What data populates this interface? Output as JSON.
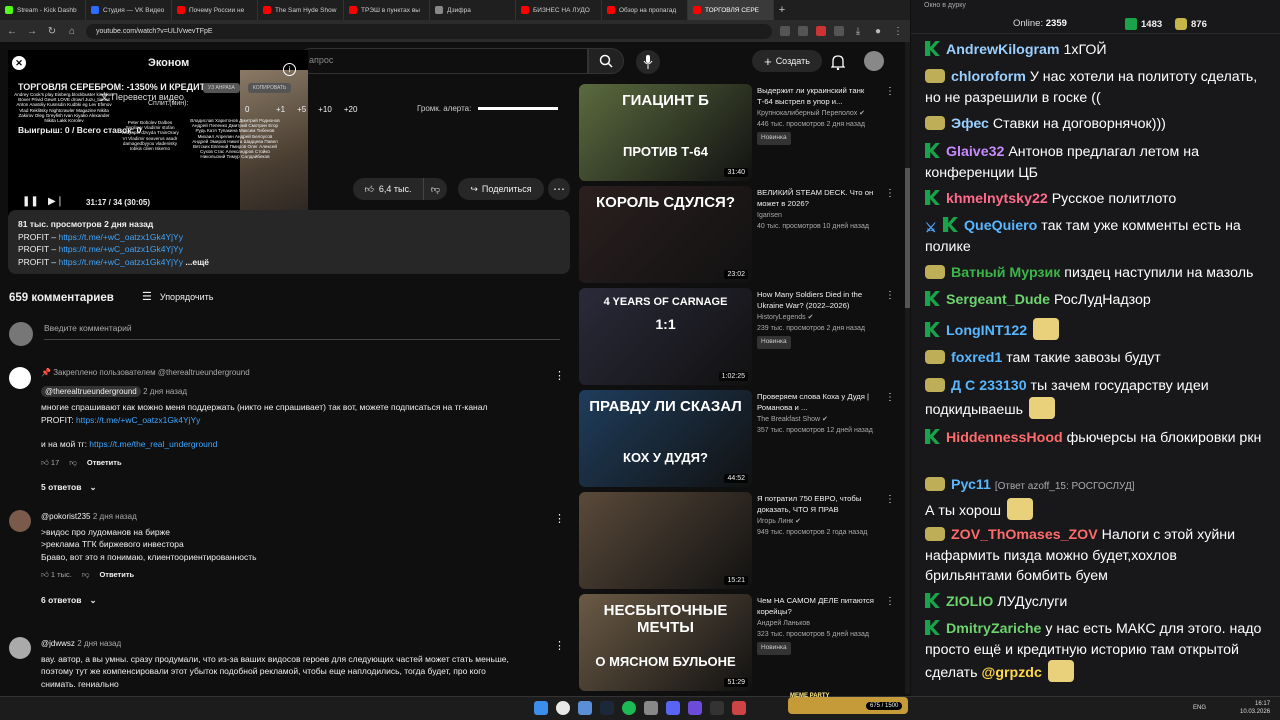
{
  "browser": {
    "tabs": [
      {
        "label": "Stream - Kick Dashb",
        "color": "#53fc18"
      },
      {
        "label": "Студия — VK Видео",
        "color": "#2c6bff"
      },
      {
        "label": "Почему России не",
        "color": "#ff0000"
      },
      {
        "label": "The Sam Hyde Show",
        "color": "#ff0000"
      },
      {
        "label": "ТРЭШ в пунктах вы",
        "color": "#ff0000"
      },
      {
        "label": "Дзифра",
        "color": "#888888"
      },
      {
        "label": "БИЗНЕС НА ЛУДО",
        "color": "#ff0000"
      },
      {
        "label": "Обзор на пропагад",
        "color": "#ff0000"
      },
      {
        "label": "ТОРГОВЛЯ СЕРЕ",
        "color": "#ff0000"
      }
    ],
    "new_tab": "+",
    "url": "youtube.com/watch?v=ULlVwevTFpE",
    "win_min": "—",
    "win_max": "☐",
    "win_close": "✕"
  },
  "header": {
    "search_placeholder": "апрос",
    "create_label": "Создать"
  },
  "overlay": {
    "brand": "Эконом",
    "title": "ТОРГОВЛЯ СЕРЕБРОМ: -1350% И КРЕДИТЫ",
    "translate": "Перевести видео",
    "chip1": "УЗ AHPA5A",
    "chip2": "КОПИРОВАТЬ",
    "split": "Сплит.(мин):",
    "counter": "0",
    "steps": [
      "+1",
      "+5",
      "+10",
      "+20"
    ],
    "volume_label": "Громк. алерта:",
    "line2": "Выигрыш: 0 / Всего ставок: 0",
    "time": "31:17 / 34 (30:05)",
    "names1": "Andrey Cook's play Eisberg.blockbuster kingdom Boxer Privid Gewrt LOVE drowrl Juzu_tiamut Anton Anatoliy Kusnsdin Kudbki eg Lev Efimov Vlad Reklitsky Nightcrawler Magazine Nikita Zakirov Oleg Greyfish Ivan Kiyako Alexander Nikita Lakk Korolev",
    "names2": "Peter Bobolev Dalbes Sepliavy Vladimir stofan Vedyapin dzvyda TrainOrary VI Vladimir seaverus asadr damagedbyyou vladenisky tobkis cilien Iskerno",
    "names3": "Владислав Харитонов Дмитрий Родионов Андрей Пепенко Дмитрий Смотрин Егор Рудь Катя Тупакина Максим Тибенов Михаил Апрелин Андрей Белоусов Андрей Эмиров Никита Шадцева Павел Вятских Евгений Пмиров Олег Алексей Сухов Стас Александров Стойко Никольский Тимур Салдайбеков"
  },
  "actions": {
    "likes": "6,4 тыс.",
    "share": "Поделиться"
  },
  "description": {
    "stats": "81 тыс. просмотров  2 дня назад",
    "profit_label": "PROFIT – ",
    "profit_link": "https://t.me/+wC_oatzx1Gk4YjYy",
    "more": "...ещё"
  },
  "comments": {
    "count": "659 комментариев",
    "sort": "Упорядочить",
    "input_placeholder": "Введите комментарий",
    "reply": "Ответить",
    "items": [
      {
        "pinned": "Закреплено пользователем @therealtrueunderground",
        "author": "@therealtrueunderground",
        "time": "2 дня назад",
        "line1": "многие спрашивают как можно меня поддержать (никто не спрашивает) так вот, можете подписаться на тг-канал",
        "line2_label": "PROFIT: ",
        "line2_link": "https://t.me/+wC_oatzx1Gk4YjYy",
        "line3_label": "и на мой тг: ",
        "line3_link": "https://t.me/the_real_underground",
        "likes": "17",
        "replies": "5 ответов"
      },
      {
        "author": "@pokorist235",
        "time": "2 дня назад",
        "line1": ">видос про лудоманов на бирже",
        "line2": ">реклама ТГК биржевого инвестора",
        "line3": "Браво, вот это я понимаю, клиентоориентированность",
        "likes": "1 тыс.",
        "replies": "6 ответов"
      },
      {
        "author": "@jdwwsz",
        "time": "2 дня назад",
        "line1": "вау. автор, а вы умны. сразу продумали, что из-за ваших видосов героев для следующих частей может стать меньше,",
        "line2": "поэтому тут же компенсировали этот убыток подобной рекламой, чтобы еще наплодились, тогда будет, про кого",
        "line3": "снимать. гениально"
      }
    ]
  },
  "recommendations": [
    {
      "thumb_text": "ГИАЦИНТ Б",
      "thumb_sub": "ПРОТИВ Т-64",
      "thumb_bg": "#5b6b3f",
      "title": "Выдержит ли украинский танк Т-64 выстрел в упор и...",
      "channel": "Крупнокалиберный Переполох ✔",
      "stats": "446 тыс. просмотров  2 дня назад",
      "badge": "Новинка",
      "duration": "31:40"
    },
    {
      "thumb_text": "КОРОЛЬ  СДУЛСЯ?",
      "thumb_sub": "",
      "thumb_bg": "#2b1f1f",
      "title": "ВЕЛИКИЙ STEAM DECK. Что он может в 2026?",
      "channel": "Igarisen",
      "stats": "40 тыс. просмотров  10 дней назад",
      "badge": "",
      "duration": "23:02"
    },
    {
      "thumb_text": "4 YEARS OF CARNAGE",
      "thumb_sub": "1:1",
      "thumb_bg": "#2a2a3a",
      "title": "How Many Soldiers Died in the Ukraine War? (2022–2026)",
      "channel": "HistoryLegends ✔",
      "stats": "239 тыс. просмотров  2 дня назад",
      "badge": "Новинка",
      "duration": "1:02:25"
    },
    {
      "thumb_text": "ПРАВДУ ЛИ СКАЗАЛ",
      "thumb_sub": "КОХ У ДУДЯ?",
      "thumb_bg": "#1f3d5c",
      "title": "Проверяем слова Коха у Дудя | Романова и ...",
      "channel": "The Breakfast Show ✔",
      "stats": "357 тыс. просмотров  12 дней назад",
      "badge": "",
      "duration": "44:52"
    },
    {
      "thumb_text": "",
      "thumb_sub": "",
      "thumb_bg": "#5a4a3a",
      "title": "Я потратил 750 ЕВРО, чтобы доказать, ЧТО Я ПРАВ",
      "channel": "Игорь Линк ✔",
      "stats": "949 тыс. просмотров  2 года назад",
      "badge": "",
      "duration": "15:21"
    },
    {
      "thumb_text": "НЕСБЫТОЧНЫЕ МЕЧТЫ",
      "thumb_sub": "О МЯСНОМ БУЛЬОНЕ",
      "thumb_bg": "#6b5a45",
      "title": "Чем НА САМОМ ДЕЛЕ питаются корейцы?",
      "channel": "Андрей Ланьков",
      "stats": "323 тыс. просмотров  5 дней назад",
      "badge": "Новинка",
      "duration": "51:29"
    }
  ],
  "chat": {
    "window_title": "Окно в дурку",
    "online_label": "Online:",
    "online_count": "2359",
    "stat1": "1483",
    "stat2": "876",
    "messages": [
      {
        "badge": "k",
        "nick": "AndrewKilogram",
        "color": "#9ad0ff",
        "text": "1хГОЙ"
      },
      {
        "badge": "y",
        "nick": "chloroform",
        "color": "#9ad0ff",
        "text": "У нас хотели на политоту сделать, но не разрешили в госке (("
      },
      {
        "badge": "y",
        "nick": "Эфес",
        "color": "#9ad0ff",
        "text": "Ставки на договорнячок)))"
      },
      {
        "badge": "k",
        "nick": "Glaive32",
        "color": "#c78bff",
        "text": "Антонов предлагал летом на конференции ЦБ"
      },
      {
        "badge": "k",
        "nick": "khmelnytsky22",
        "color": "#ff6b8a",
        "text": "Русское политлото"
      },
      {
        "badge": "xk",
        "nick": "QueQuiero",
        "color": "#58b7ff",
        "text": "так там уже комменты есть на полике"
      },
      {
        "badge": "y",
        "nick": "Ватный Мурзик",
        "color": "#3bb54a",
        "text": "пиздец наступили на мазоль"
      },
      {
        "badge": "k",
        "nick": "Sergeant_Dude",
        "color": "#6dd36d",
        "text": "РосЛудНадзор"
      },
      {
        "badge": "k",
        "nick": "LongINT122",
        "color": "#58b7ff",
        "text": ""
      },
      {
        "badge": "y",
        "nick": "foxred1",
        "color": "#58b7ff",
        "text": "там такие завозы будут"
      },
      {
        "badge": "y",
        "nick": "Д С 233130",
        "color": "#58b7ff",
        "text": "ты зачем государству идеи подкидываешь"
      },
      {
        "badge": "k",
        "nick": "HiddennessHood",
        "color": "#ff6b6b",
        "text": "фьючерсы на блокировки ркн"
      },
      {
        "badge": "y",
        "nick": "Рус11",
        "color": "#58b7ff",
        "reply": "[Ответ azoff_15: РОСГОСЛУД]",
        "text": "А ты хорош"
      },
      {
        "badge": "y",
        "nick": "ZOV_ThOmases_ZOV",
        "color": "#ff6b6b",
        "text": "Налоги с этой хуйни нафармить пизда можно будет,хохлов брильянтами бомбить буем"
      },
      {
        "badge": "k",
        "nick": "ZIOLIO",
        "color": "#6dd36d",
        "text": "ЛУДуслуги"
      },
      {
        "badge": "k",
        "nick": "DmitryZariche",
        "color": "#6dd36d",
        "text": "у нас есть МАКС для этого. надо просто ещё и кредитную историю там открытой сделать",
        "mention": "@grpzdc"
      }
    ]
  },
  "taskbar": {
    "meme_label": "MEME PARTY",
    "meme_value": "675 / 1500",
    "lang": "ENG",
    "time": "16:17",
    "date": "10.03.2026"
  }
}
